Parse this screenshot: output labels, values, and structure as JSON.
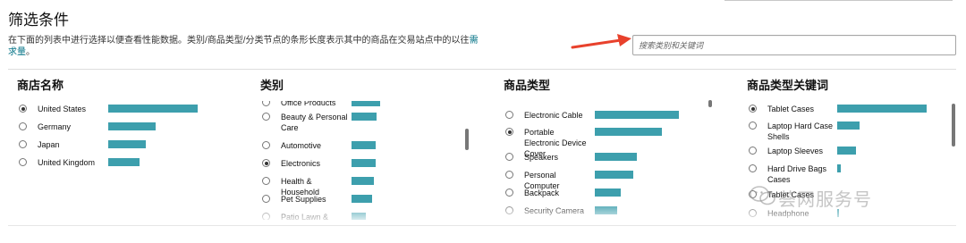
{
  "header": {
    "title": "筛选条件",
    "desc_before": "在下面的列表中进行选择以便查看性能数据。类别/商品类型/分类节点的条形长度表示其中的商品在交易站点中的以往",
    "desc_link": "需求量",
    "desc_after": "。"
  },
  "search": {
    "placeholder": "搜索类别和关键词"
  },
  "watermark": {
    "text": "荟网服务号"
  },
  "panels": [
    {
      "title": "商店名称",
      "items": [
        {
          "label": "United States",
          "checked": true,
          "bar_share": 1.0
        },
        {
          "label": "Germany",
          "checked": false,
          "bar_share": 0.53
        },
        {
          "label": "Japan",
          "checked": false,
          "bar_share": 0.42
        },
        {
          "label": "United Kingdom",
          "checked": false,
          "bar_share": 0.35
        }
      ]
    },
    {
      "title": "类别",
      "items": [
        {
          "label": "Office Products",
          "checked": false,
          "bar_share": 1.0
        },
        {
          "label": "Beauty & Personal Care",
          "checked": false,
          "bar_share": 0.87
        },
        {
          "label": "Automotive",
          "checked": false,
          "bar_share": 0.83
        },
        {
          "label": "Electronics",
          "checked": true,
          "bar_share": 0.83
        },
        {
          "label": "Health & Household",
          "checked": false,
          "bar_share": 0.77
        },
        {
          "label": "Pet Supplies",
          "checked": false,
          "bar_share": 0.73
        },
        {
          "label": "Patio Lawn &",
          "checked": false,
          "bar_share": 0.5
        }
      ]
    },
    {
      "title": "商品类型",
      "items": [
        {
          "label": "Electronic Cable",
          "checked": false,
          "bar_share": 1.0
        },
        {
          "label": "Portable Electronic Device Cover",
          "checked": true,
          "bar_share": 0.8
        },
        {
          "label": "Speakers",
          "checked": false,
          "bar_share": 0.5
        },
        {
          "label": "Personal Computer",
          "checked": false,
          "bar_share": 0.46
        },
        {
          "label": "Backpack",
          "checked": false,
          "bar_share": 0.31
        },
        {
          "label": "Security Camera",
          "checked": false,
          "bar_share": 0.27
        }
      ]
    },
    {
      "title": "商品类型关键词",
      "items": [
        {
          "label": "Tablet Cases",
          "checked": true,
          "bar_share": 1.0
        },
        {
          "label": "Laptop Hard Case Shells",
          "checked": false,
          "bar_share": 0.25
        },
        {
          "label": "Laptop Sleeves",
          "checked": false,
          "bar_share": 0.21
        },
        {
          "label": "Hard Drive Bags Cases",
          "checked": false,
          "bar_share": 0.04
        },
        {
          "label": "Tablet Cases",
          "checked": false,
          "bar_share": 0.0
        },
        {
          "label": "Headphone Cases",
          "checked": false,
          "bar_share": 0.02
        }
      ]
    }
  ]
}
